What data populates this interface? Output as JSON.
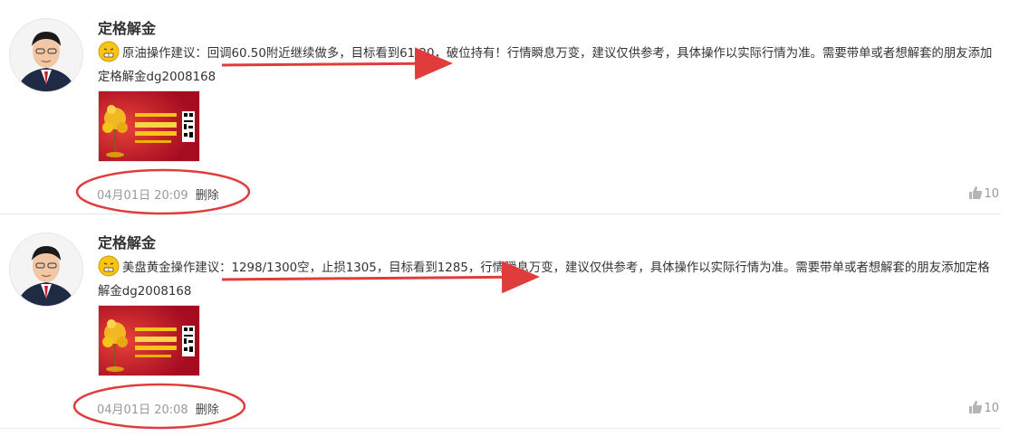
{
  "posts": [
    {
      "author": "定格解金",
      "content": "原油操作建议：回调60.50附近继续做多，目标看到61.20，破位持有！行情瞬息万变，建议仅供参考，具体操作以实际行情为准。需要带单或者想解套的朋友添加定格解金dg2008168",
      "timestamp": "04月01日 20:09",
      "delete_label": "删除",
      "likes": "10"
    },
    {
      "author": "定格解金",
      "content": "美盘黄金操作建议：1298/1300空，止损1305，目标看到1285，行情瞬息万变，建议仅供参考，具体操作以实际行情为准。需要带单或者想解套的朋友添加定格解金dg2008168",
      "timestamp": "04月01日 20:08",
      "delete_label": "删除",
      "likes": "10"
    }
  ],
  "colors": {
    "annotation": "#e03c3c",
    "banner_red": "#c8102e",
    "gold": "#f5c518"
  },
  "icons": {
    "emoji": "grimace-emoji-icon",
    "like": "thumbs-up-icon"
  }
}
